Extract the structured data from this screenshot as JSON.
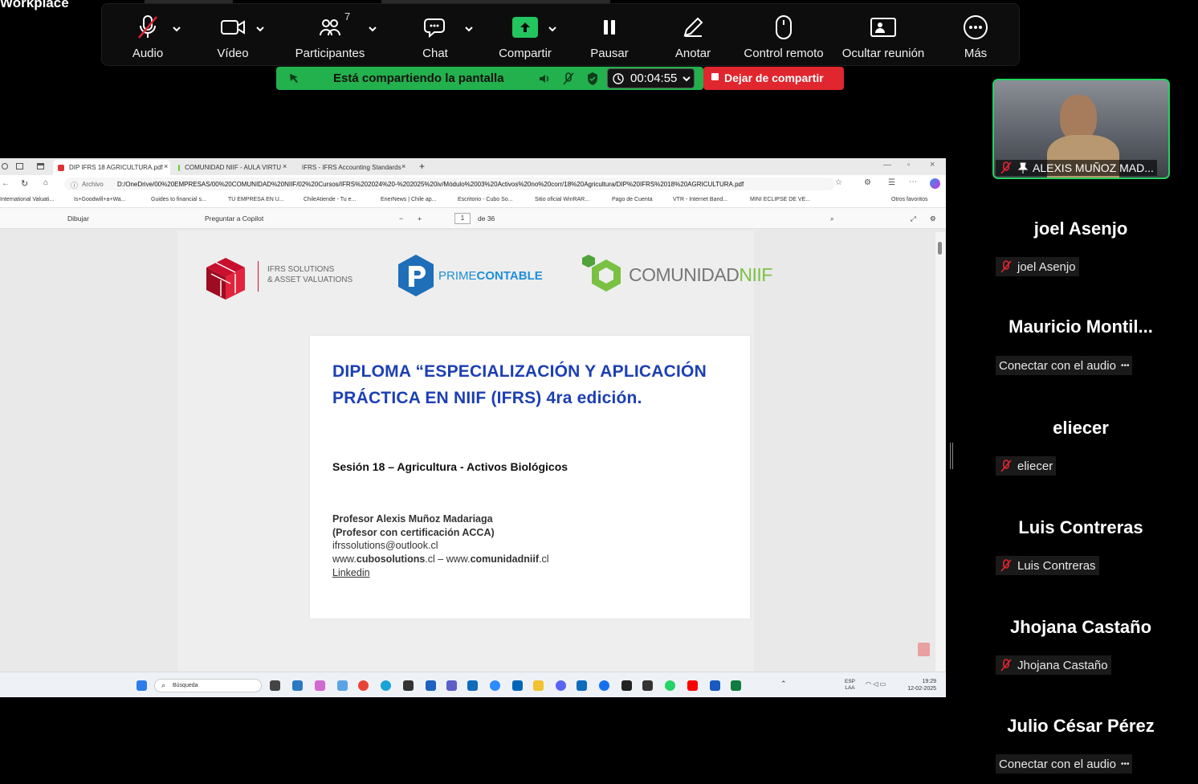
{
  "app": {
    "brand": "Workplace"
  },
  "toolbar": {
    "items": [
      {
        "label": "Audio",
        "icon": "microphone-muted-icon"
      },
      {
        "label": "Vídeo",
        "icon": "video-camera-icon"
      },
      {
        "label": "Participantes",
        "icon": "participants-icon",
        "count": "7"
      },
      {
        "label": "Chat",
        "icon": "chat-icon"
      },
      {
        "label": "Compartir",
        "icon": "share-screen-icon"
      },
      {
        "label": "Pausar",
        "icon": "pause-icon"
      },
      {
        "label": "Anotar",
        "icon": "pencil-icon"
      },
      {
        "label": "Control remoto",
        "icon": "mouse-icon"
      },
      {
        "label": "Ocultar reunión",
        "icon": "hide-meeting-icon"
      },
      {
        "label": "Más",
        "icon": "more-icon"
      }
    ]
  },
  "sharebar": {
    "status": "Está compartiendo la pantalla",
    "timer": "00:04:55",
    "stop": "Dejar de compartir"
  },
  "browser": {
    "tabs": [
      {
        "title": "DIP IFRS 18 AGRICULTURA.pdf"
      },
      {
        "title": "COMUNIDAD NIIF - AULA VIRTU"
      },
      {
        "title": "IFRS - IFRS Accounting Standards"
      }
    ],
    "archivo": "Archivo",
    "url": "D:/OneDrive/00%20EMPRESAS/00%20COMUNIDAD%20NIIF/02%20Cursos/IFRS%202024%20-%202025%20iv/Módulo%2003%20Activos%20no%20corr/18%20Agricultura/DIP%20IFRS%2018%20AGRICULTURA.pdf",
    "bookmarks": [
      "International Valuati...",
      "Is+Goodwill+a+Wa...",
      "Guides to financial s...",
      "TU EMPRESA EN U...",
      "ChileAtiende - Tu e...",
      "EnerNews | Chile ap...",
      "Escritorio - Cubo So...",
      "Sitio oficial WinRAR...",
      "Pago de Cuenta",
      "VTR - Internet Band...",
      "MINI ECLIPSE DE VE..."
    ],
    "other_favorites": "Otros favoritos"
  },
  "pdf_toolbar": {
    "draw": "Dibujar",
    "copilot": "Preguntar a Copilot",
    "page": "1",
    "of": "de 36"
  },
  "slide": {
    "logo1_line1": "IFRS SOLUTIONS",
    "logo1_line2": "& ASSET VALUATIONS",
    "logo2_a": "PRIME",
    "logo2_b": "CONTABLE",
    "logo3_a": "COMUNIDAD",
    "logo3_b": "NIIF",
    "title": "DIPLOMA “ESPECIALIZACIÓN Y APLICACIÓN PRÁCTICA EN NIIF (IFRS) 4ra edición.",
    "session": "Sesión 18 – Agricultura - Activos Biológicos",
    "prof": "Profesor Alexis Muñoz Madariaga",
    "cert": "(Profesor con certificación ACCA)",
    "email": "ifrssolutions@outlook.cl",
    "web_prefix": "www.",
    "web1": "cubosolutions",
    "web_mid": ".cl – www.",
    "web2": "comunidadniif",
    "web_suffix": ".cl",
    "linkedin": "Linkedin"
  },
  "taskbar": {
    "search": "Búsqueda",
    "lang1": "ESP",
    "lang2": "LAA",
    "time": "19:29",
    "date": "12-02-2025"
  },
  "participants": {
    "video_name": "ALEXIS MUÑOZ MAD...",
    "list": [
      {
        "display": "joel Asenjo",
        "label": "joel Asenjo",
        "muted": true
      },
      {
        "display": "Mauricio  Montil...",
        "label": "Conectar con el audio",
        "muted": false
      },
      {
        "display": "eliecer",
        "label": "eliecer",
        "muted": true
      },
      {
        "display": "Luis Contreras",
        "label": "Luis Contreras",
        "muted": true
      },
      {
        "display": "Jhojana Castaño",
        "label": "Jhojana Castaño",
        "muted": true
      },
      {
        "display": "Julio César Pérez",
        "label": "Conectar con el audio",
        "muted": false
      }
    ]
  },
  "colors": {
    "share_green": "#23b14d",
    "stop_red": "#e0262e",
    "title_blue": "#1c3fb3",
    "active_tile": "#23d160"
  }
}
